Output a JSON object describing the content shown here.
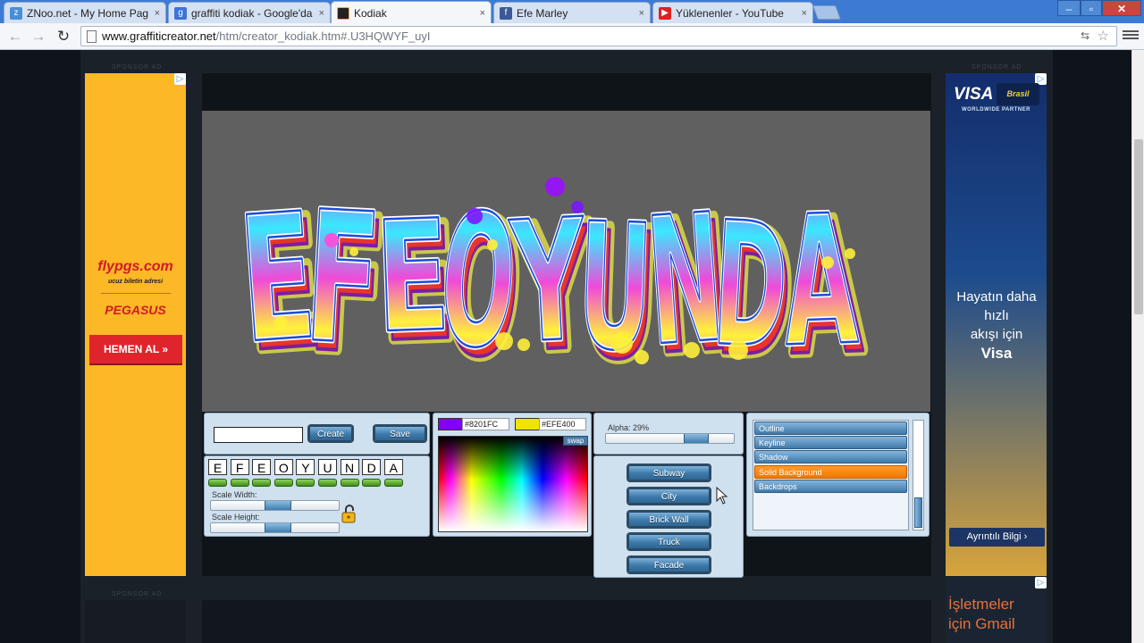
{
  "browser": {
    "tabs": [
      {
        "label": "ZNoo.net - My Home Pag",
        "favicon": "znoo-icon"
      },
      {
        "label": "graffiti kodiak - Google'da",
        "favicon": "google-icon"
      },
      {
        "label": "Kodiak",
        "favicon": "kodiak-icon"
      },
      {
        "label": "Efe Marley",
        "favicon": "facebook-icon"
      },
      {
        "label": "Yüklenenler - YouTube",
        "favicon": "youtube-icon"
      }
    ],
    "close_glyph": "×",
    "url_host": "www.graffiticreator.net",
    "url_path": "/htm/creator_kodiak.htm#.U3HQWYF_uyI"
  },
  "ads": {
    "sponsor_label": "SPONSOR AD",
    "left": {
      "brand": "flypgs.com",
      "slogan": "ucuz biletin adresi",
      "airline": "PEGASUS",
      "cta": "HEMEN AL »"
    },
    "right": {
      "logo": "VISA",
      "badge": "Brasil",
      "partner": "WORLDWIDE PARTNER",
      "line1": "Hayatın daha",
      "line2": "hızlı",
      "line3": "akışı için",
      "line4": "Visa",
      "cta": "Ayrıntılı Bilgi  ›"
    },
    "gmail": {
      "line1": "İşletmeler",
      "line2": "için Gmail"
    }
  },
  "creator": {
    "graffiti_text": "EFEOYUNDA",
    "text_input_value": "",
    "create_label": "Create",
    "save_label": "Save",
    "letters": [
      "E",
      "F",
      "E",
      "O",
      "Y",
      "U",
      "N",
      "D",
      "A"
    ],
    "scale_width_label": "Scale Width:",
    "scale_height_label": "Scale Height:",
    "scale_width_value": 0.4,
    "scale_height_value": 0.4,
    "color1": "#8201FC",
    "color1_label": "#8201FC",
    "color2": "#EFE400",
    "color2_label": "#EFE400",
    "swap_label": "swap",
    "alpha_label": "Alpha: 29%",
    "alpha_value": 0.29,
    "backgrounds": [
      "Subway",
      "City",
      "Brick Wall",
      "Truck",
      "Facade"
    ],
    "layers": [
      "Outline",
      "Keyline",
      "Shadow",
      "Solid Background",
      "Backdrops"
    ],
    "selected_layer": "Solid Background"
  },
  "colors": {
    "accent_blue": "#3c79aa",
    "selected_orange": "#f07800",
    "canvas_gray": "#606060"
  }
}
